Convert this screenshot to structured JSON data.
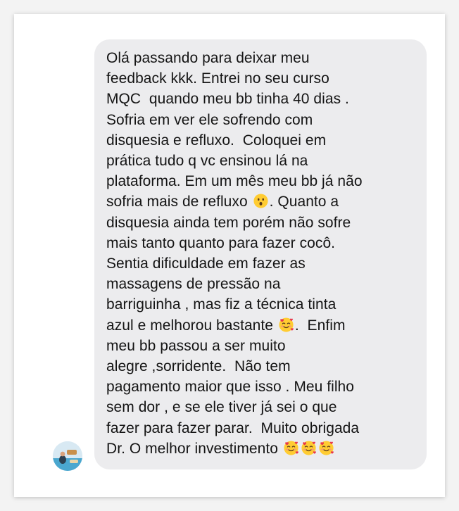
{
  "message": {
    "lines": [
      "Olá passando para deixar meu",
      "feedback kkk. Entrei no seu curso",
      "MQC  quando meu bb tinha 40 dias .",
      "Sofria em ver ele sofrendo com",
      "disquesia e refluxo.  Coloquei em",
      "prática tudo q vc ensinou lá na",
      "plataforma. Em um mês meu bb já não",
      "sofria mais de refluxo ",
      ". Quanto a",
      "disquesia ainda tem porém não sofre",
      "mais tanto quanto para fazer cocô.",
      "Sentia dificuldade em fazer as",
      "massagens de pressão na",
      "barriguinha , mas fiz a técnica tinta",
      "azul e melhorou bastante ",
      ".  Enfim",
      "meu bb passou a ser muito",
      "alegre ,sorridente.  Não tem",
      "pagamento maior que isso . Meu filho",
      "sem dor , e se ele tiver já sei o que",
      "fazer para fazer parar.  Muito obrigada",
      "Dr. O melhor investimento "
    ],
    "emojis": {
      "surprised": "hushed-face-emoji",
      "love": "smiling-face-with-hearts-emoji"
    }
  },
  "colors": {
    "bubble": "#ececee",
    "text": "#141414",
    "card": "#ffffff"
  }
}
